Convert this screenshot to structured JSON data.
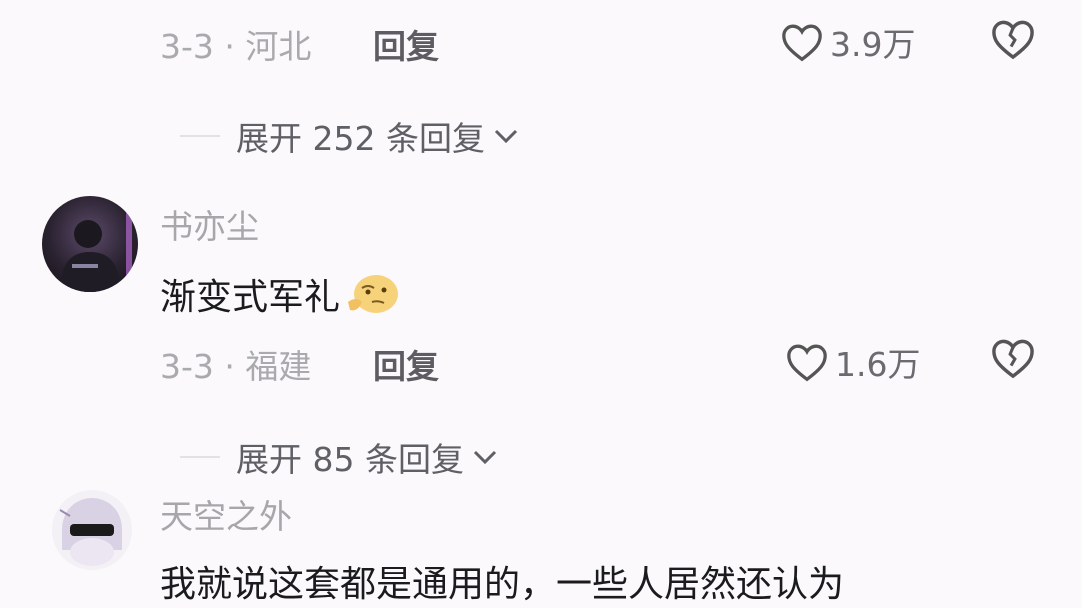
{
  "comments": [
    {
      "meta": "3-3 · 河北",
      "reply_label": "回复",
      "likes": "3.9万",
      "expand_label": "展开 252 条回复"
    },
    {
      "username": "书亦尘",
      "content": "渐变式军礼",
      "meta": "3-3 · 福建",
      "reply_label": "回复",
      "likes": "1.6万",
      "expand_label": "展开 85 条回复"
    },
    {
      "username": "天空之外",
      "content": "我就说这套都是通用的，一些人居然还认为"
    }
  ],
  "icons": {
    "heart": "heart-outline-icon",
    "dislike": "broken-heart-icon",
    "chevron": "chevron-down-icon",
    "emoji": "thinking-face-emoji"
  }
}
